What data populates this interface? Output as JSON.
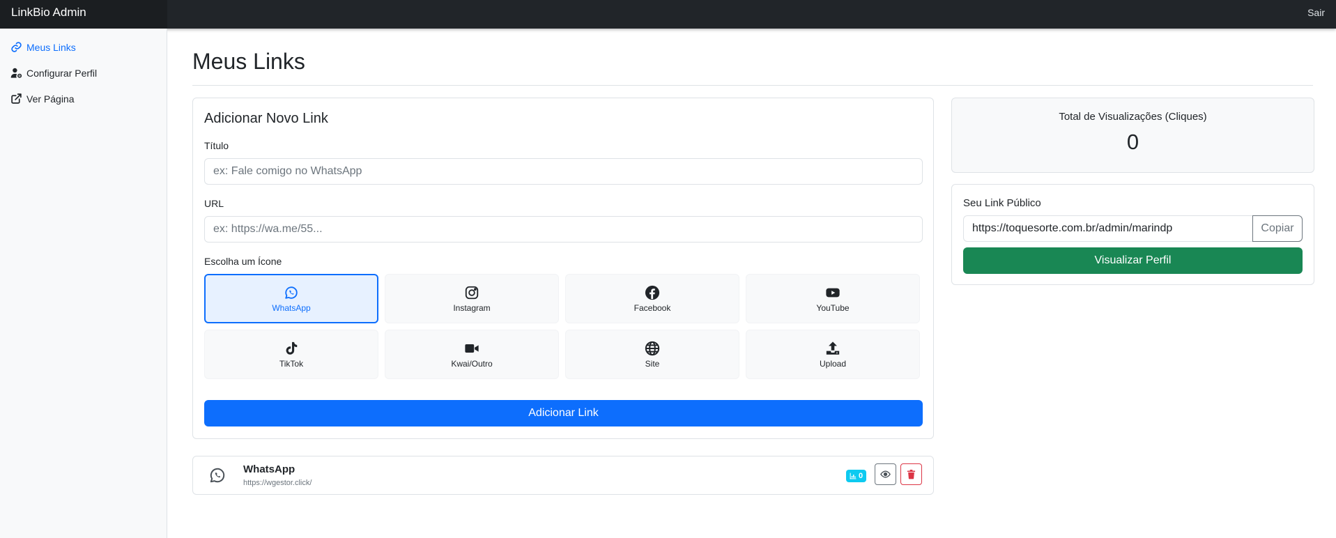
{
  "navbar": {
    "brand": "LinkBio Admin",
    "logout": "Sair"
  },
  "sidebar": {
    "items": [
      {
        "label": "Meus Links",
        "icon": "link-icon",
        "active": true
      },
      {
        "label": "Configurar Perfil",
        "icon": "user-gear-icon"
      },
      {
        "label": "Ver Página",
        "icon": "external-link-icon"
      }
    ]
  },
  "main": {
    "title": "Meus Links"
  },
  "add_link_form": {
    "title": "Adicionar Novo Link",
    "title_label": "Título",
    "title_placeholder": "ex: Fale comigo no WhatsApp",
    "url_label": "URL",
    "url_placeholder": "ex: https://wa.me/55...",
    "icon_label": "Escolha um Ícone",
    "icons": [
      {
        "label": "WhatsApp",
        "icon": "whatsapp-icon",
        "selected": true
      },
      {
        "label": "Instagram",
        "icon": "instagram-icon"
      },
      {
        "label": "Facebook",
        "icon": "facebook-icon"
      },
      {
        "label": "YouTube",
        "icon": "youtube-icon"
      },
      {
        "label": "TikTok",
        "icon": "tiktok-icon"
      },
      {
        "label": "Kwai/Outro",
        "icon": "video-camera-icon"
      },
      {
        "label": "Site",
        "icon": "globe-icon"
      },
      {
        "label": "Upload",
        "icon": "upload-icon"
      }
    ],
    "submit_label": "Adicionar Link"
  },
  "links": [
    {
      "title": "WhatsApp",
      "url": "https://wgestor.click/",
      "clicks": "0",
      "icon": "whatsapp-icon"
    }
  ],
  "stats": {
    "label": "Total de Visualizações (Cliques)",
    "value": "0"
  },
  "public_link": {
    "label": "Seu Link Público",
    "value": "https://toquesorte.com.br/admin/marindp",
    "copy_label": "Copiar",
    "view_label": "Visualizar Perfil"
  },
  "colors": {
    "primary": "#0d6efd",
    "success": "#198754",
    "danger": "#dc3545",
    "info": "#0dcaf0",
    "navbar": "#212529"
  }
}
